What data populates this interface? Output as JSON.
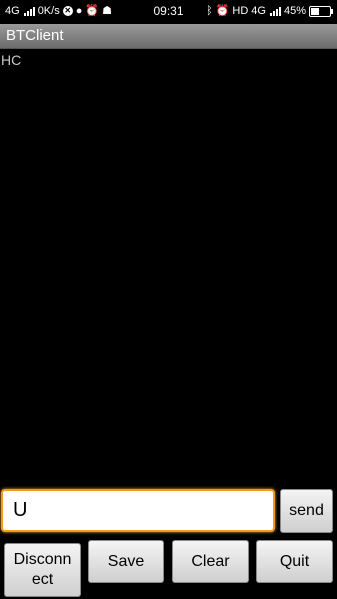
{
  "status_bar": {
    "network": "4G",
    "speed": "0K/s",
    "time": "09:31",
    "hd": "HD",
    "right_network": "4G",
    "battery": "45%",
    "battery_level": 0.45
  },
  "app": {
    "title": "BTClient"
  },
  "output": {
    "text": "HC"
  },
  "input": {
    "value": "U"
  },
  "buttons": {
    "send": "send",
    "disconnect": "Disconn\nect",
    "save": "Save",
    "clear": "Clear",
    "quit": "Quit"
  }
}
